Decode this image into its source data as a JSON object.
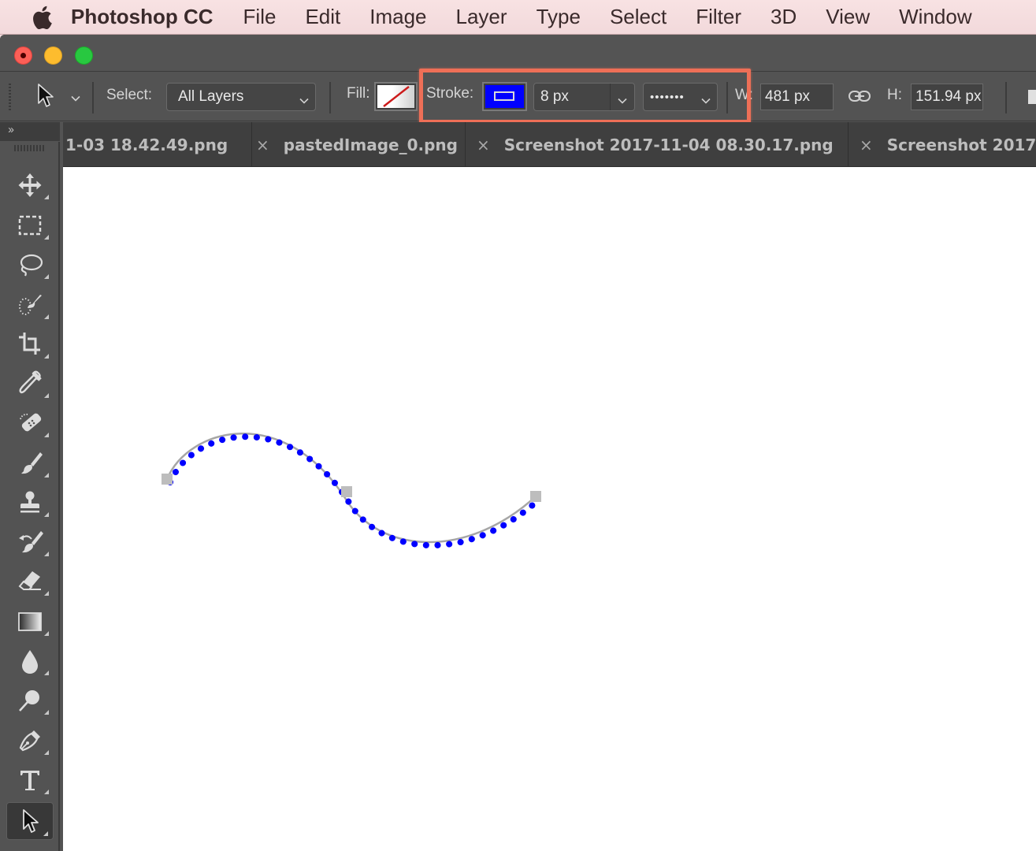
{
  "menubar": {
    "apple_icon": "apple-logo-icon",
    "app_name": "Photoshop CC",
    "items": [
      "File",
      "Edit",
      "Image",
      "Layer",
      "Type",
      "Select",
      "Filter",
      "3D",
      "View",
      "Window"
    ]
  },
  "window": {
    "controls": [
      "close",
      "minimize",
      "maximize"
    ]
  },
  "options_bar": {
    "tool_icon": "path-selection-arrow-icon",
    "select_label": "Select:",
    "select_value": "All Layers",
    "fill_label": "Fill:",
    "fill_value": "none",
    "stroke_label": "Stroke:",
    "stroke_color": "#0000ff",
    "stroke_width": "8 px",
    "stroke_style": "•••••••",
    "w_label": "W:",
    "w_value": "481 px",
    "link_icon": "link-icon",
    "h_label": "H:",
    "h_value": "151.94 px",
    "highlight_color": "#ee6f57"
  },
  "tabs": [
    {
      "label": "1-03 18.42.49.png",
      "closable": false
    },
    {
      "label": "pastedImage_0.png",
      "closable": true
    },
    {
      "label": "Screenshot 2017-11-04 08.30.17.png",
      "closable": true
    },
    {
      "label": "Screenshot 2017-",
      "closable": true
    }
  ],
  "tab_close_glyph": "×",
  "toolbox": {
    "collapse_glyph": "››",
    "tools": [
      {
        "name": "move-tool",
        "active": false
      },
      {
        "name": "rectangular-marquee-tool",
        "active": false
      },
      {
        "name": "lasso-tool",
        "active": false
      },
      {
        "name": "quick-selection-tool",
        "active": false
      },
      {
        "name": "crop-tool",
        "active": false
      },
      {
        "name": "eyedropper-tool",
        "active": false
      },
      {
        "name": "spot-healing-brush-tool",
        "active": false
      },
      {
        "name": "brush-tool",
        "active": false
      },
      {
        "name": "clone-stamp-tool",
        "active": false
      },
      {
        "name": "history-brush-tool",
        "active": false
      },
      {
        "name": "eraser-tool",
        "active": false
      },
      {
        "name": "gradient-tool",
        "active": false
      },
      {
        "name": "blur-tool",
        "active": false
      },
      {
        "name": "dodge-tool",
        "active": false
      },
      {
        "name": "pen-tool",
        "active": false
      },
      {
        "name": "type-tool",
        "active": false
      },
      {
        "name": "path-selection-tool",
        "active": true
      }
    ]
  },
  "canvas": {
    "path": {
      "stroke_color": "#0000ff",
      "stroke_style": "dotted",
      "path_outline_color": "#a6a6a6",
      "anchor_color": "#bdbdbd",
      "anchor_count": 3
    }
  }
}
